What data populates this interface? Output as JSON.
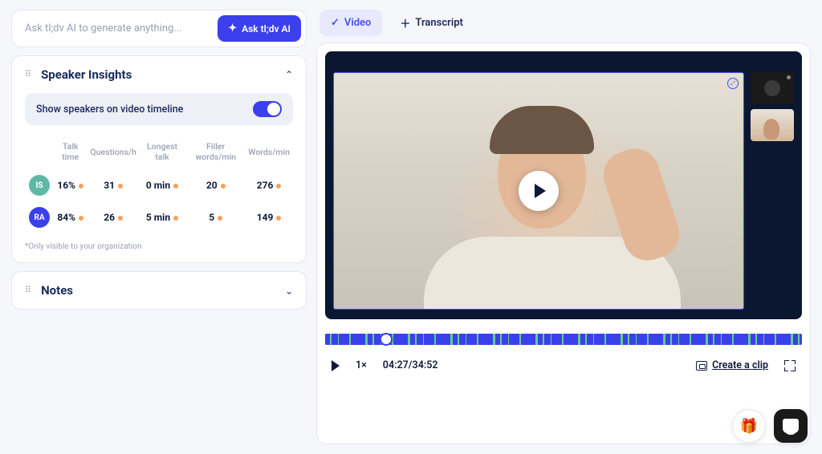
{
  "ai": {
    "placeholder": "Ask tl;dv AI to generate anything...",
    "button_label": "Ask tl;dv AI"
  },
  "speaker_insights": {
    "title": "Speaker Insights",
    "toggle_label": "Show speakers on video timeline",
    "toggle_on": true,
    "columns": {
      "talk_time": "Talk time",
      "questions": "Questions/h",
      "longest": "Longest talk",
      "filler": "Filler words/min",
      "wpm": "Words/min"
    },
    "rows": [
      {
        "initials": "IS",
        "color": "#5fb8a5",
        "talk_time": "16%",
        "questions": "31",
        "longest": "0 min",
        "filler": "20",
        "wpm": "276"
      },
      {
        "initials": "RA",
        "color": "#3b3fec",
        "talk_time": "84%",
        "questions": "26",
        "longest": "5 min",
        "filler": "5",
        "wpm": "149"
      }
    ],
    "footnote": "*Only visible to your organization"
  },
  "notes": {
    "title": "Notes"
  },
  "tabs": {
    "video": "Video",
    "transcript": "Transcript"
  },
  "player": {
    "speed": "1×",
    "current": "04:27",
    "duration": "34:52",
    "clip_label": "Create a clip"
  }
}
